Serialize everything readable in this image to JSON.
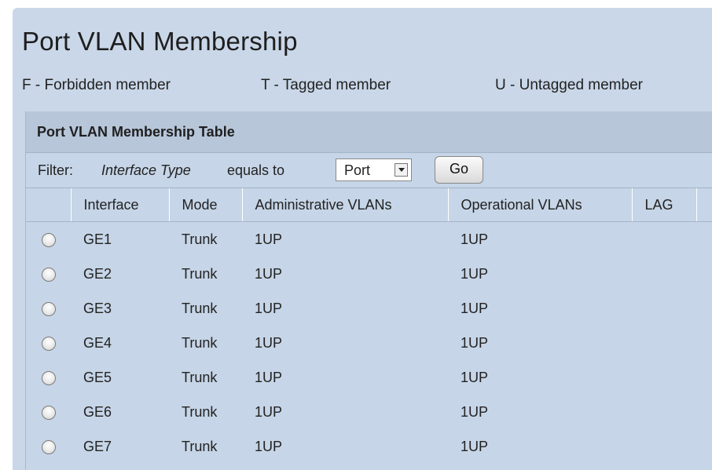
{
  "page": {
    "title": "Port VLAN Membership",
    "legend": [
      "F - Forbidden member",
      "T - Tagged member",
      "U - Untagged member"
    ]
  },
  "table": {
    "title": "Port VLAN Membership Table",
    "filter": {
      "label": "Filter:",
      "field": "Interface Type",
      "operator": "equals to",
      "selected": "Port",
      "go_label": "Go"
    },
    "columns": [
      "Interface",
      "Mode",
      "Administrative VLANs",
      "Operational VLANs",
      "LAG"
    ],
    "rows": [
      {
        "interface": "GE1",
        "mode": "Trunk",
        "admin_vlans": "1UP",
        "oper_vlans": "1UP",
        "lag": ""
      },
      {
        "interface": "GE2",
        "mode": "Trunk",
        "admin_vlans": "1UP",
        "oper_vlans": "1UP",
        "lag": ""
      },
      {
        "interface": "GE3",
        "mode": "Trunk",
        "admin_vlans": "1UP",
        "oper_vlans": "1UP",
        "lag": ""
      },
      {
        "interface": "GE4",
        "mode": "Trunk",
        "admin_vlans": "1UP",
        "oper_vlans": "1UP",
        "lag": ""
      },
      {
        "interface": "GE5",
        "mode": "Trunk",
        "admin_vlans": "1UP",
        "oper_vlans": "1UP",
        "lag": ""
      },
      {
        "interface": "GE6",
        "mode": "Trunk",
        "admin_vlans": "1UP",
        "oper_vlans": "1UP",
        "lag": ""
      },
      {
        "interface": "GE7",
        "mode": "Trunk",
        "admin_vlans": "1UP",
        "oper_vlans": "1UP",
        "lag": ""
      }
    ]
  },
  "colors": {
    "panel_bg": "#c9d7e8",
    "table_header_bg": "#b7c6d9"
  }
}
